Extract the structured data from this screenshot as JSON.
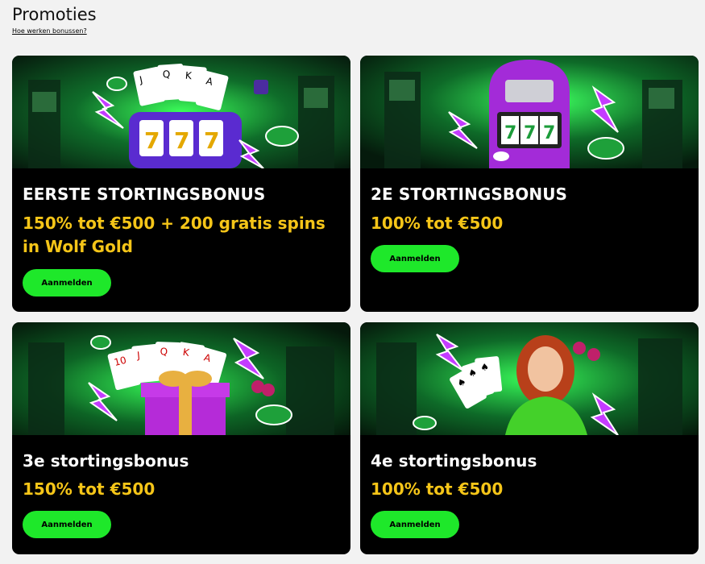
{
  "header": {
    "title": "Promoties",
    "help_link": "Hoe werken bonussen?"
  },
  "colors": {
    "background": "#f2f2f2",
    "card": "#000000",
    "offer_text": "#f5c518",
    "cta": "#1ee82a",
    "accent_purple": "#9b2bd8",
    "accent_green": "#19d43a"
  },
  "promotions": [
    {
      "title": "EERSTE STORTINGSBONUS",
      "offer": "150% tot €500 + 200 gratis spins in Wolf Gold",
      "cta": "Aanmelden",
      "image": "slot-machine-777-with-cards-and-chips"
    },
    {
      "title": "2E STORTINGSBONUS",
      "offer": "100% tot €500",
      "cta": "Aanmelden",
      "image": "purple-jukebox-slot-777"
    },
    {
      "title": "3e stortingsbonus",
      "offer": "150% tot €500",
      "cta": "Aanmelden",
      "image": "purple-gift-box-with-cards"
    },
    {
      "title": "4e stortingsbonus",
      "offer": "100% tot €500",
      "cta": "Aanmelden",
      "image": "red-haired-woman-with-cards"
    }
  ]
}
